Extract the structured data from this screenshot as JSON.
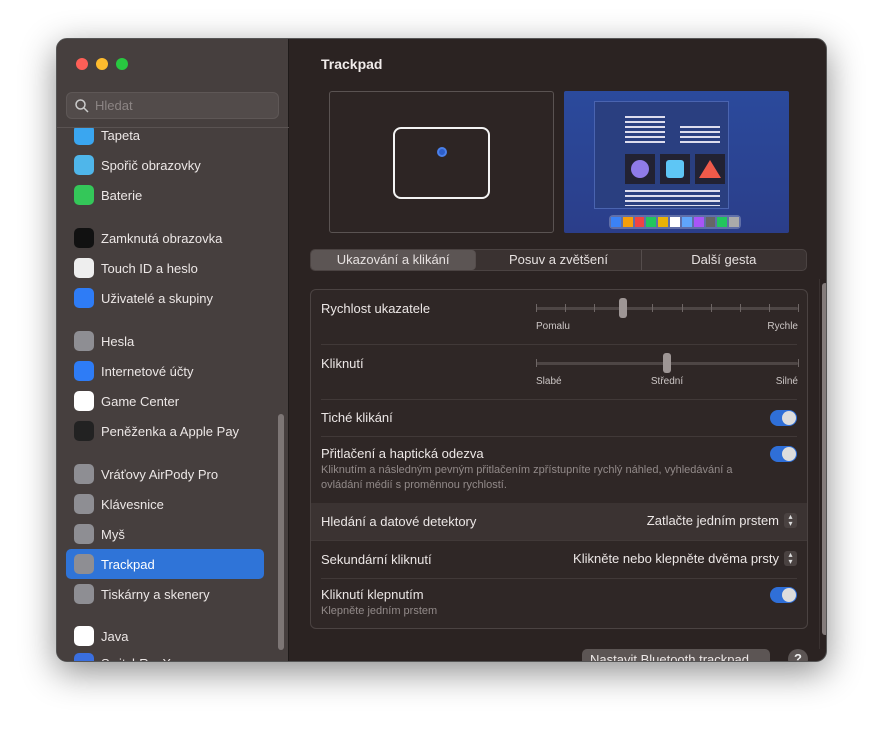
{
  "sidebar": {
    "search_placeholder": "Hledat",
    "items": [
      {
        "label": "Tapeta",
        "icon": "wallpaper-icon",
        "color": "#3aa6f0"
      },
      {
        "label": "Spořič obrazovky",
        "icon": "screensaver-icon",
        "color": "#4fb6ea"
      },
      {
        "label": "Baterie",
        "icon": "battery-icon",
        "color": "#34c759"
      },
      {
        "label": "Zamknutá obrazovka",
        "icon": "lock-icon",
        "color": "#111111"
      },
      {
        "label": "Touch ID a heslo",
        "icon": "fingerprint-icon",
        "color": "#eeeeee"
      },
      {
        "label": "Uživatelé a skupiny",
        "icon": "users-icon",
        "color": "#2e7cf6"
      },
      {
        "label": "Hesla",
        "icon": "key-icon",
        "color": "#8e8e93"
      },
      {
        "label": "Internetové účty",
        "icon": "at-icon",
        "color": "#2e7cf6"
      },
      {
        "label": "Game Center",
        "icon": "game-center-icon",
        "color": "#ffffff"
      },
      {
        "label": "Peněženka a Apple Pay",
        "icon": "wallet-icon",
        "color": "#222222"
      },
      {
        "label": "Vráťovy AirPody Pro",
        "icon": "airpods-icon",
        "color": "#8e8e93"
      },
      {
        "label": "Klávesnice",
        "icon": "keyboard-icon",
        "color": "#8e8e93"
      },
      {
        "label": "Myš",
        "icon": "mouse-icon",
        "color": "#8e8e93"
      },
      {
        "label": "Trackpad",
        "icon": "trackpad-icon",
        "color": "#8e8e93"
      },
      {
        "label": "Tiskárny a skenery",
        "icon": "printer-icon",
        "color": "#8e8e93"
      },
      {
        "label": "Java",
        "icon": "java-icon",
        "color": "#ffffff"
      },
      {
        "label": "SwitchResX",
        "icon": "switchresx-icon",
        "color": "#3a6fe0"
      }
    ]
  },
  "main": {
    "title": "Trackpad",
    "tabs": [
      "Ukazování a klikání",
      "Posuv a zvětšení",
      "Další gesta"
    ],
    "pointer_speed": {
      "label": "Rychlost ukazatele",
      "min_label": "Pomalu",
      "max_label": "Rychle",
      "value": 0.333,
      "ticks": 10
    },
    "click": {
      "label": "Kliknutí",
      "labels": [
        "Slabé",
        "Střední",
        "Silné"
      ],
      "value": 0.5
    },
    "silent_click": {
      "label": "Tiché klikání",
      "on": true
    },
    "force_click": {
      "label": "Přitlačení a haptická odezva",
      "desc": "Kliknutím a následným pevným přitlačením zpřístupníte rychlý náhled, vyhledávání a ovládání médií s proměnnou rychlostí.",
      "on": true
    },
    "lookup": {
      "label": "Hledání a datové detektory",
      "value": "Zatlačte jedním prstem"
    },
    "secondary": {
      "label": "Sekundární kliknutí",
      "value": "Klikněte nebo klepněte dvěma prsty"
    },
    "tap": {
      "label": "Kliknutí klepnutím",
      "desc": "Klepněte jedním prstem",
      "on": true
    },
    "bt_button": "Nastavit Bluetooth trackpad…",
    "help": "?"
  },
  "accent": "#2f74d8"
}
